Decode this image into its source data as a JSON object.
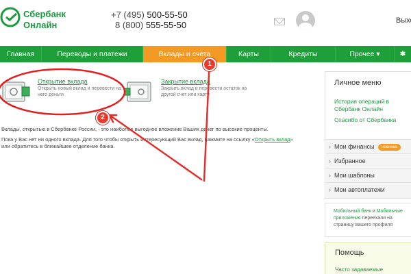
{
  "header": {
    "logo_line1": "Сбербанк",
    "logo_line2": "Онлайн",
    "phone1_prefix": "+7 (495) ",
    "phone1_number": "500-55-50",
    "phone2_prefix": "8 (800) ",
    "phone2_number": "555-55-50",
    "logout_label": "Выход",
    "mail_icon": "mail-icon",
    "avatar_icon": "user-avatar-icon"
  },
  "nav": {
    "items": [
      {
        "label": "Главная"
      },
      {
        "label": "Переводы и платежи"
      },
      {
        "label": "Вклады и счета",
        "active": true
      },
      {
        "label": "Карты"
      },
      {
        "label": "Кредиты"
      },
      {
        "label": "Прочее ▾"
      },
      {
        "label": "✱"
      }
    ]
  },
  "actions": {
    "open": {
      "title": "Открытие вклада",
      "desc": "Открыть новый вклад и перевести на него деньги."
    },
    "close": {
      "title": "Закрытие вклада",
      "desc": "Закрыть вклад и перевести остаток на другой счет или карту."
    }
  },
  "content": {
    "info1": "Вклады, открытые в Сбербанке России, - это наиболее выгодное вложение Ваших денег по высокие проценты.",
    "info2_before": "Пока у Вас нет ни одного вклада. Для того чтобы открыть интересующий Вас вклад, нажмите на ссылку «",
    "info2_link": "Открыть вклад",
    "info2_after": "» или обратитесь в ближайшее отделение банка."
  },
  "side_menu": {
    "title": "Личное меню",
    "link1": "История операций в Сбербанк Онлайн",
    "link2": "Спасибо от Сбербанка",
    "rows": [
      {
        "label": "Мои финансы",
        "badge": "новинка"
      },
      {
        "label": "Избранное"
      },
      {
        "label": "Мои шаблоны"
      },
      {
        "label": "Мои автоплатежи"
      }
    ]
  },
  "promo": {
    "link1": "Мобильный банк",
    "mid": " и ",
    "link2": "Мобильные приложения",
    "rest": " переехали на страницу вашего профиля"
  },
  "help": {
    "title": "Помощь",
    "link": "Часто задаваемые"
  },
  "annotations": {
    "marker1": "1",
    "marker2": "2",
    "color": "#e83a2f"
  },
  "colors": {
    "brand_green": "#1f9f3a",
    "nav_active": "#f39a25",
    "link_green": "#1a9a3d"
  }
}
